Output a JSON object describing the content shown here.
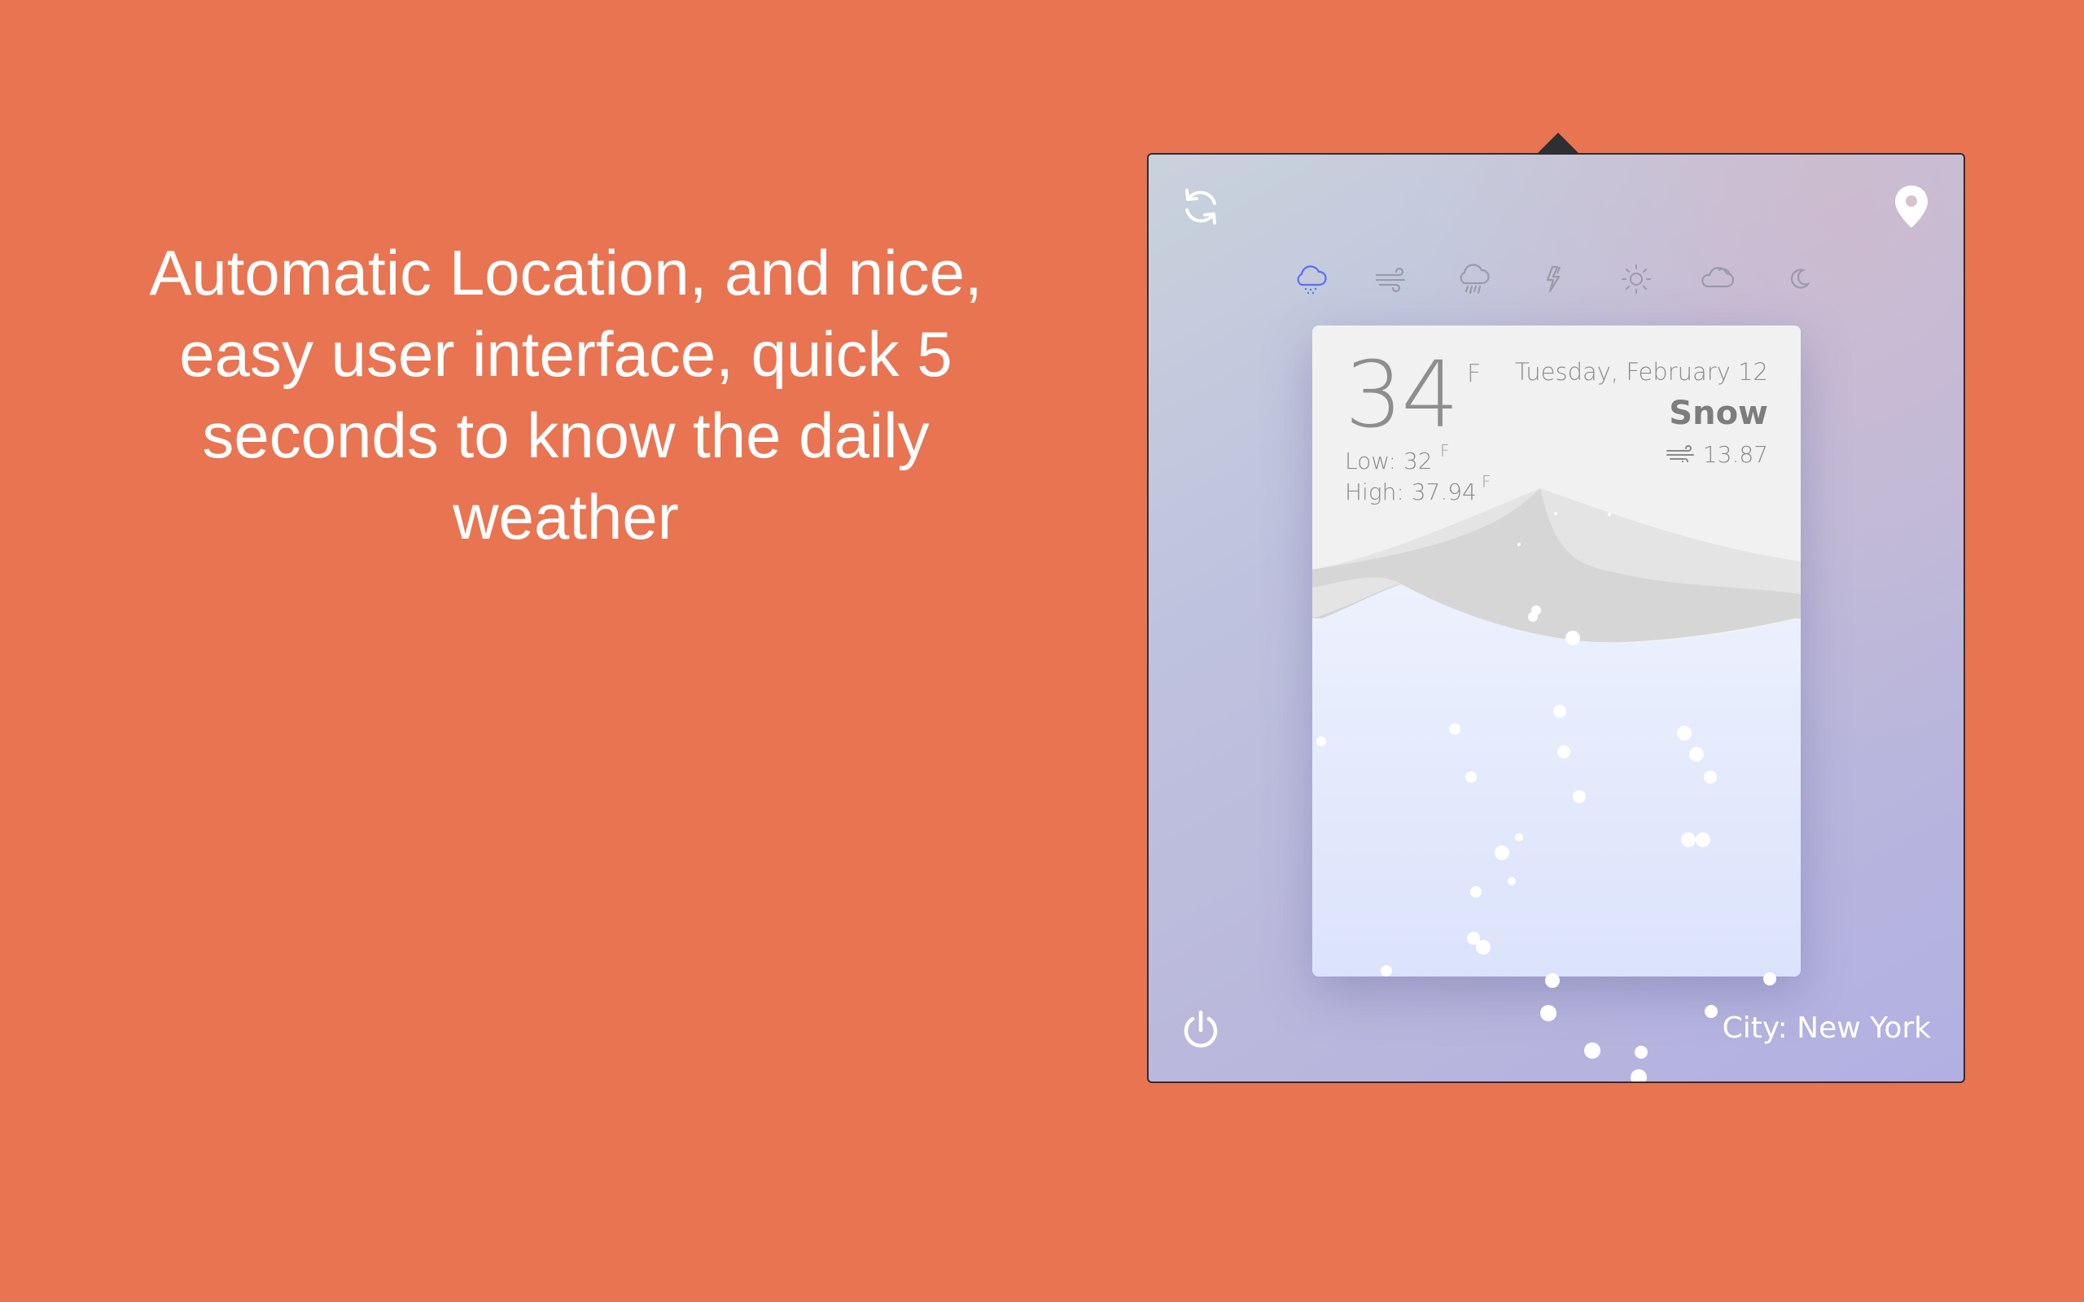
{
  "promo": {
    "text": "Automatic Location, and nice,\neasy user interface, quick 5\nseconds to know the daily\nweather"
  },
  "toolbar": {
    "refresh_icon": "refresh-icon",
    "location_icon": "location-pin-icon",
    "power_icon": "power-icon"
  },
  "weather_icons": [
    {
      "name": "snow-cloud-icon",
      "active": true
    },
    {
      "name": "wind-icon",
      "active": false
    },
    {
      "name": "rain-cloud-icon",
      "active": false
    },
    {
      "name": "lightning-icon",
      "active": false
    },
    {
      "name": "sun-icon",
      "active": false
    },
    {
      "name": "cloud-icon",
      "active": false
    },
    {
      "name": "moon-icon",
      "active": false
    }
  ],
  "card": {
    "temperature": "34",
    "temp_unit": "F",
    "low": "Low: 32",
    "low_unit": "F",
    "high": "High: 37.94",
    "high_unit": "F",
    "date": "Tuesday, February 12",
    "condition": "Snow",
    "wind_speed": "13.87"
  },
  "footer": {
    "city": "City: New York"
  },
  "colors": {
    "background": "#e97451",
    "active_icon": "#5b6ef0",
    "inactive_icon": "#9a9aaa"
  }
}
